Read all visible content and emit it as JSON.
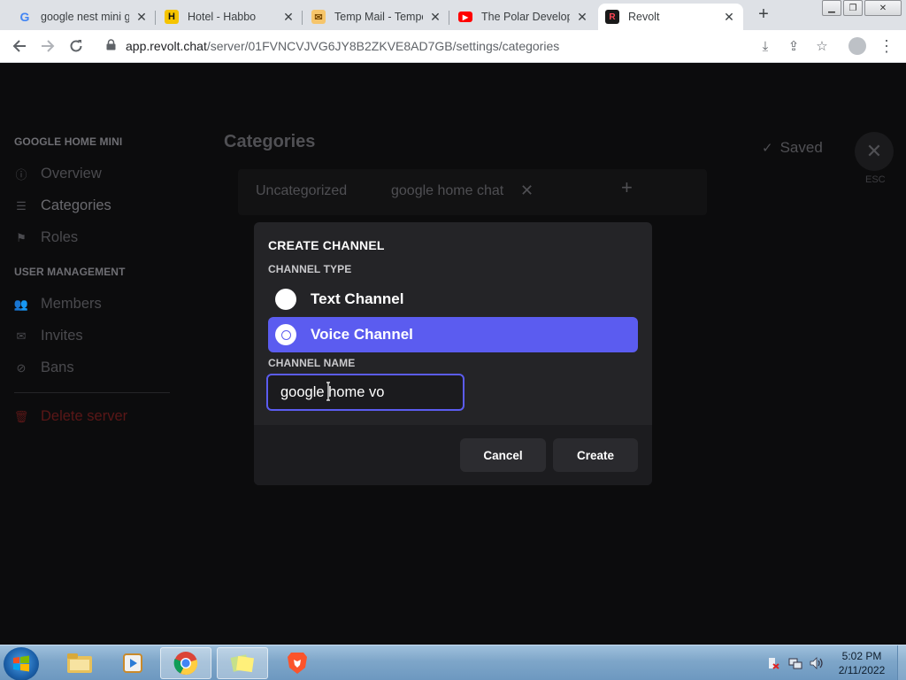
{
  "browser": {
    "tabs": [
      {
        "title": "google nest mini g",
        "favicon": "google-g-icon",
        "active": false
      },
      {
        "title": "Hotel - Habbo",
        "favicon": "habbo-icon",
        "active": false
      },
      {
        "title": "Temp Mail - Tempo",
        "favicon": "tempmail-icon",
        "active": false
      },
      {
        "title": "The Polar Develope",
        "favicon": "youtube-icon",
        "active": false
      },
      {
        "title": "Revolt",
        "favicon": "revolt-icon",
        "active": true
      }
    ],
    "new_tab": "+",
    "url_host": "app.revolt.chat",
    "url_path": "/server/01FVNCVJVG6JY8B2ZKVE8AD7GB/settings/categories"
  },
  "sidebar": {
    "server_heading": "GOOGLE HOME MINI",
    "items": [
      {
        "label": "Overview",
        "icon": "info-icon"
      },
      {
        "label": "Categories",
        "icon": "list-icon"
      },
      {
        "label": "Roles",
        "icon": "flag-icon"
      }
    ],
    "user_heading": "USER MANAGEMENT",
    "user_items": [
      {
        "label": "Members",
        "icon": "group-icon"
      },
      {
        "label": "Invites",
        "icon": "envelope-icon"
      },
      {
        "label": "Bans",
        "icon": "ban-icon"
      }
    ],
    "delete_label": "Delete server"
  },
  "main": {
    "title": "Categories",
    "saved_label": "Saved",
    "esc_label": "ESC",
    "categories": [
      "Uncategorized",
      "google home chat"
    ]
  },
  "modal": {
    "title": "CREATE CHANNEL",
    "channel_type_label": "CHANNEL TYPE",
    "options": [
      {
        "label": "Text Channel",
        "selected": false
      },
      {
        "label": "Voice Channel",
        "selected": true
      }
    ],
    "channel_name_label": "CHANNEL NAME",
    "channel_name_value": "google home vo",
    "cancel_label": "Cancel",
    "create_label": "Create"
  },
  "taskbar": {
    "apps": [
      "explorer-icon",
      "media-player-icon",
      "chrome-icon",
      "sticky-notes-icon",
      "brave-icon"
    ],
    "time": "5:02 PM",
    "date": "2/11/2022"
  },
  "colors": {
    "accent": "#5b5cf0",
    "modal_bg": "#242427",
    "page_bg": "#0c0c0d"
  }
}
